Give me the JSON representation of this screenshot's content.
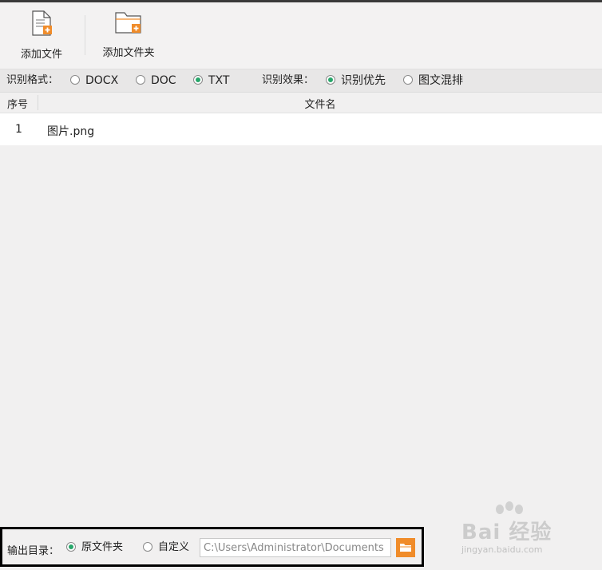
{
  "toolbar": {
    "add_file_label": "添加文件",
    "add_folder_label": "添加文件夹"
  },
  "options": {
    "format_label": "识别格式：",
    "formats": [
      {
        "label": "DOCX",
        "selected": false
      },
      {
        "label": "DOC",
        "selected": false
      },
      {
        "label": "TXT",
        "selected": true
      }
    ],
    "effect_label": "识别效果：",
    "effects": [
      {
        "label": "识别优先",
        "selected": true
      },
      {
        "label": "图文混排",
        "selected": false
      }
    ]
  },
  "table": {
    "headers": [
      "序号",
      "文件名"
    ],
    "rows": [
      {
        "index": "1",
        "name": "图片.png"
      }
    ]
  },
  "output": {
    "label": "输出目录：",
    "option_original": "原文件夹",
    "option_custom": "自定义",
    "selected": "原文件夹",
    "path_value": "C:\\Users\\Administrator\\Documents"
  },
  "watermark": {
    "brand": "Bai 经验",
    "url": "jingyan.baidu.com"
  },
  "colors": {
    "accent_green": "#27a66a",
    "accent_orange": "#f08c2a",
    "background": "#f1f0f0"
  },
  "icons": [
    "add-file-icon",
    "add-folder-icon",
    "folder-browse-icon"
  ]
}
